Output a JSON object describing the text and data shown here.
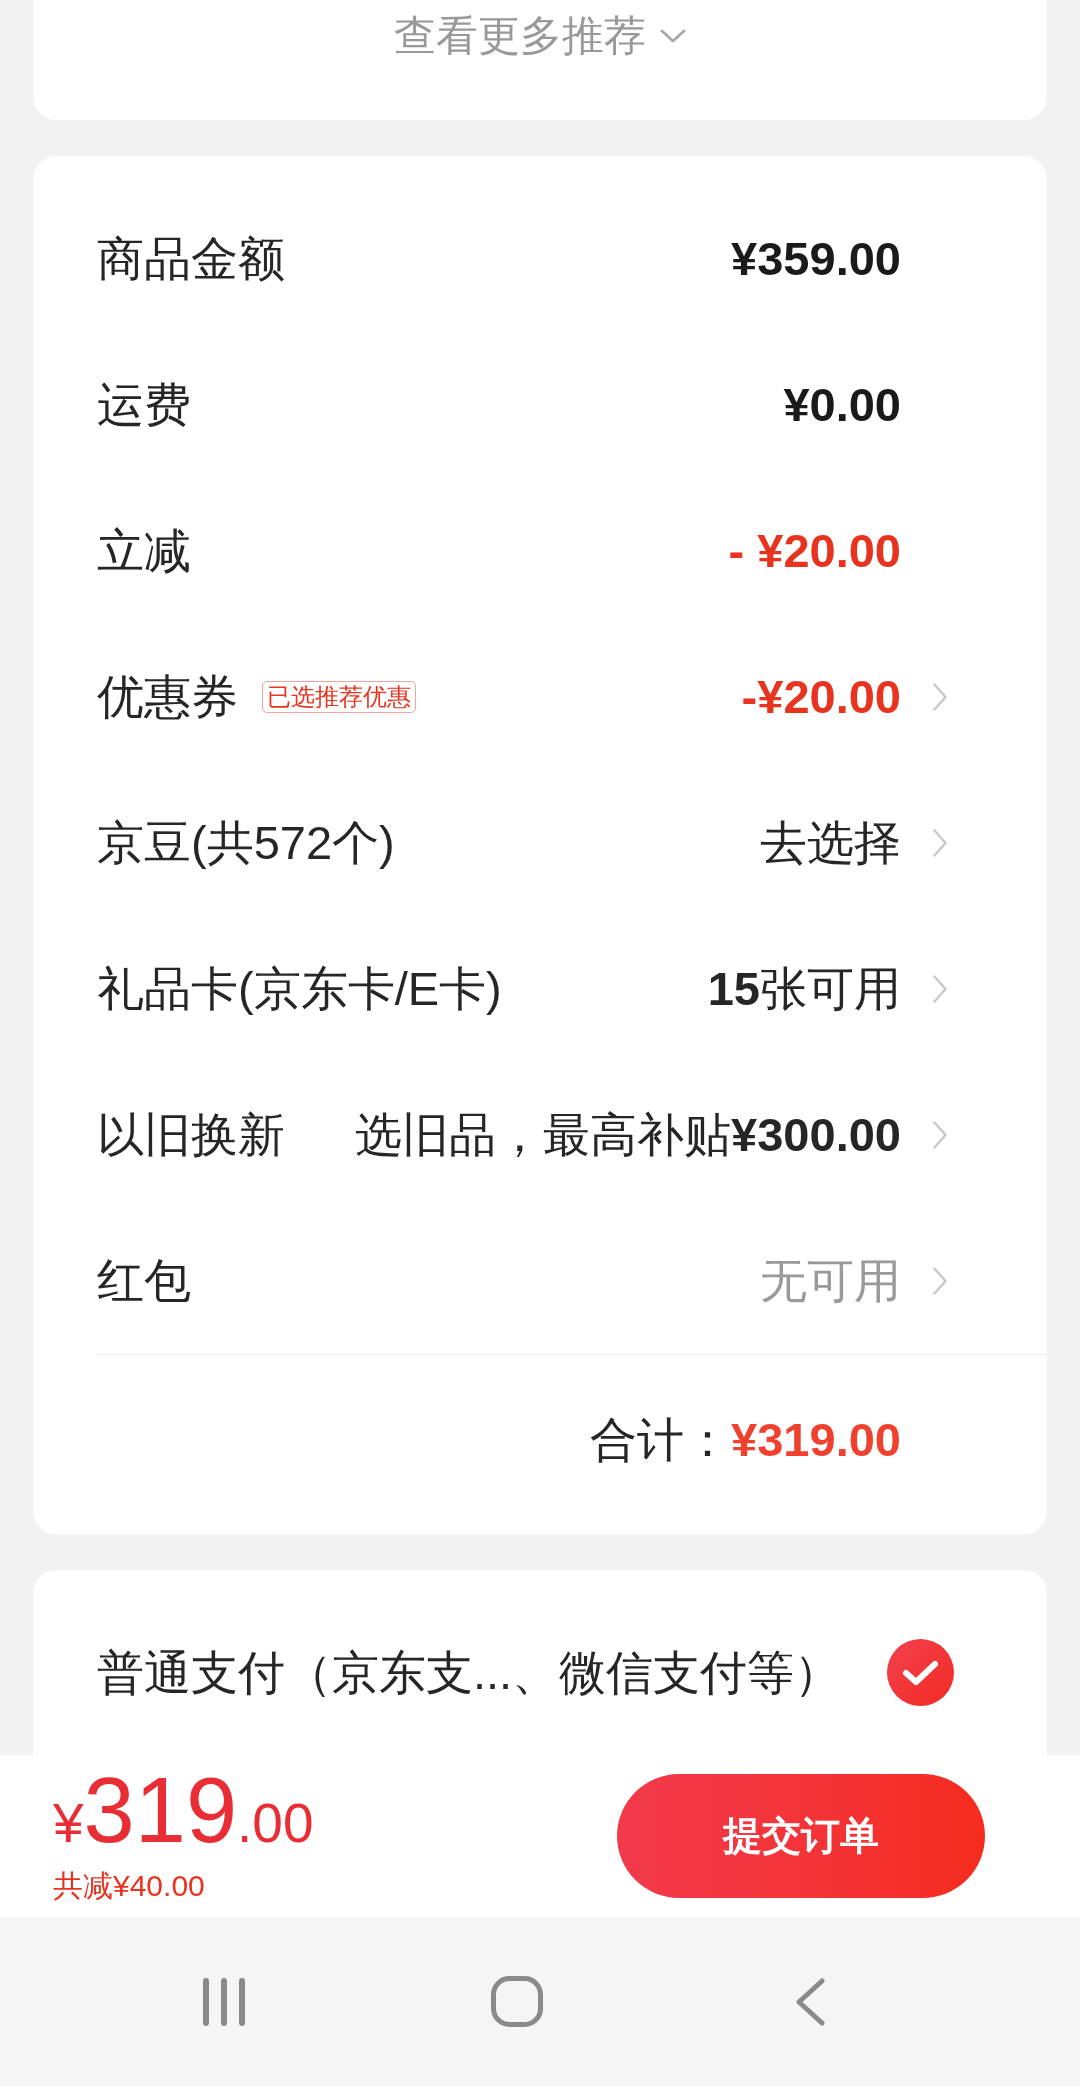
{
  "recommendations": {
    "more_button": "查看更多推荐"
  },
  "summary": {
    "rows": [
      {
        "label": "商品金额",
        "value": "¥359.00",
        "kind": "amount",
        "chevron": false
      },
      {
        "label": "运费",
        "value": "¥0.00",
        "kind": "amount",
        "chevron": false
      },
      {
        "label": "立减",
        "value": "- ¥20.00",
        "kind": "discount",
        "chevron": false
      },
      {
        "label": "优惠券",
        "badge": "已选推荐优惠",
        "value": "-¥20.00",
        "kind": "discount",
        "chevron": true
      },
      {
        "label": "京豆(共572个)",
        "value": "去选择",
        "kind": "text",
        "chevron": true
      },
      {
        "label": "礼品卡(京东卡/E卡)",
        "value": "**15**张可用",
        "kind": "text",
        "chevron": true
      },
      {
        "label": "以旧换新",
        "value": "选旧品，最高补贴**¥300.00**",
        "kind": "text",
        "chevron": true
      },
      {
        "label": "红包",
        "value": "无可用",
        "kind": "muted",
        "chevron": true
      }
    ],
    "total_label": "合计：",
    "total_value": "¥319.00"
  },
  "payment_options": [
    {
      "label": "普通支付（京东支...、微信支付等）",
      "selected": true
    }
  ],
  "bottom_bar": {
    "currency": "¥",
    "price_integer": "319",
    "price_decimal": ".00",
    "savings": "共减¥40.00",
    "submit_button": "提交订单"
  }
}
